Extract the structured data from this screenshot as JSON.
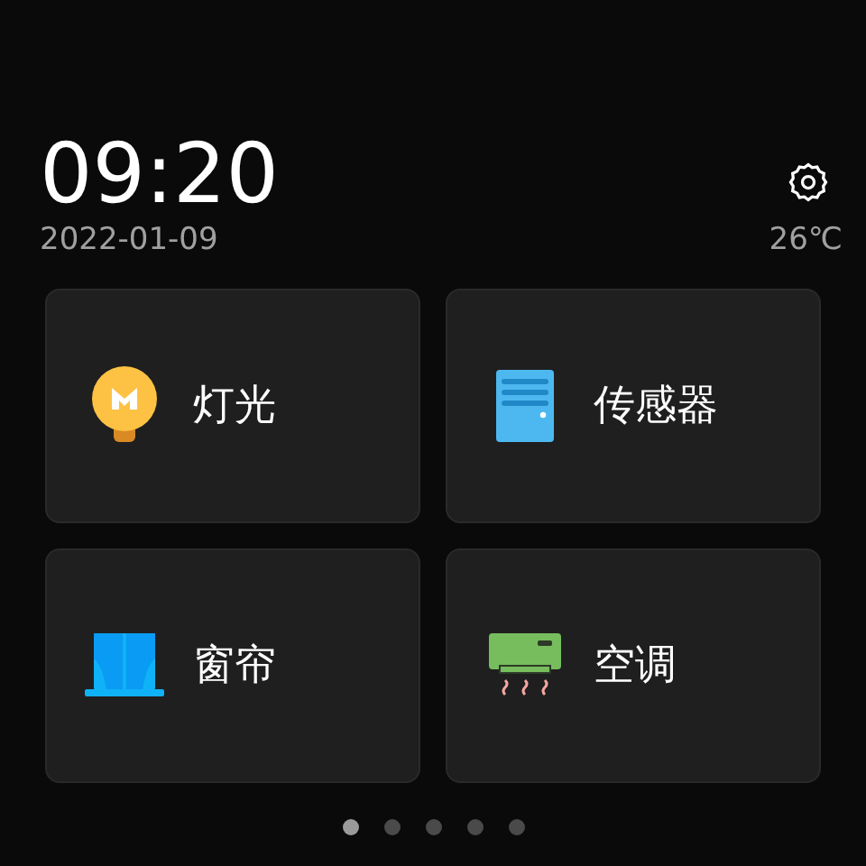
{
  "clock": {
    "time": "09:20",
    "date": "2022-01-09"
  },
  "weather": {
    "temperature": "26℃"
  },
  "devices": [
    {
      "kind": "bulb",
      "label": "灯光"
    },
    {
      "kind": "sensor",
      "label": "传感器"
    },
    {
      "kind": "curtain",
      "label": "窗帘"
    },
    {
      "kind": "aircon",
      "label": "空调"
    }
  ],
  "pages": [
    {
      "selected": true
    },
    {
      "selected": false
    },
    {
      "selected": false
    },
    {
      "selected": false
    },
    {
      "selected": false
    }
  ]
}
